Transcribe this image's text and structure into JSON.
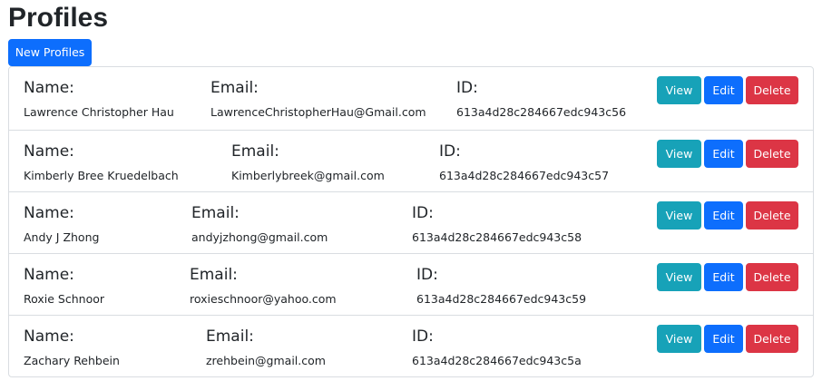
{
  "page": {
    "title": "Profiles",
    "new_button_label": "New Profiles"
  },
  "labels": {
    "name": "Name:",
    "email": "Email:",
    "id": "ID:"
  },
  "actions": {
    "view": "View",
    "edit": "Edit",
    "delete": "Delete"
  },
  "colors": {
    "primary": "#0d6efd",
    "info": "#17a2b8",
    "danger": "#dc3545"
  },
  "profiles": [
    {
      "name": "Lawrence Christopher Hau",
      "email": "LawrenceChristopherHau@Gmail.com",
      "id": "613a4d28c284667edc943c56"
    },
    {
      "name": "Kimberly Bree Kruedelbach",
      "email": "Kimberlybreek@gmail.com",
      "id": "613a4d28c284667edc943c57"
    },
    {
      "name": "Andy J Zhong",
      "email": "andyjzhong@gmail.com",
      "id": "613a4d28c284667edc943c58"
    },
    {
      "name": "Roxie Schnoor",
      "email": "roxieschnoor@yahoo.com",
      "id": "613a4d28c284667edc943c59"
    },
    {
      "name": "Zachary Rehbein",
      "email": "zrehbein@gmail.com",
      "id": "613a4d28c284667edc943c5a"
    }
  ]
}
